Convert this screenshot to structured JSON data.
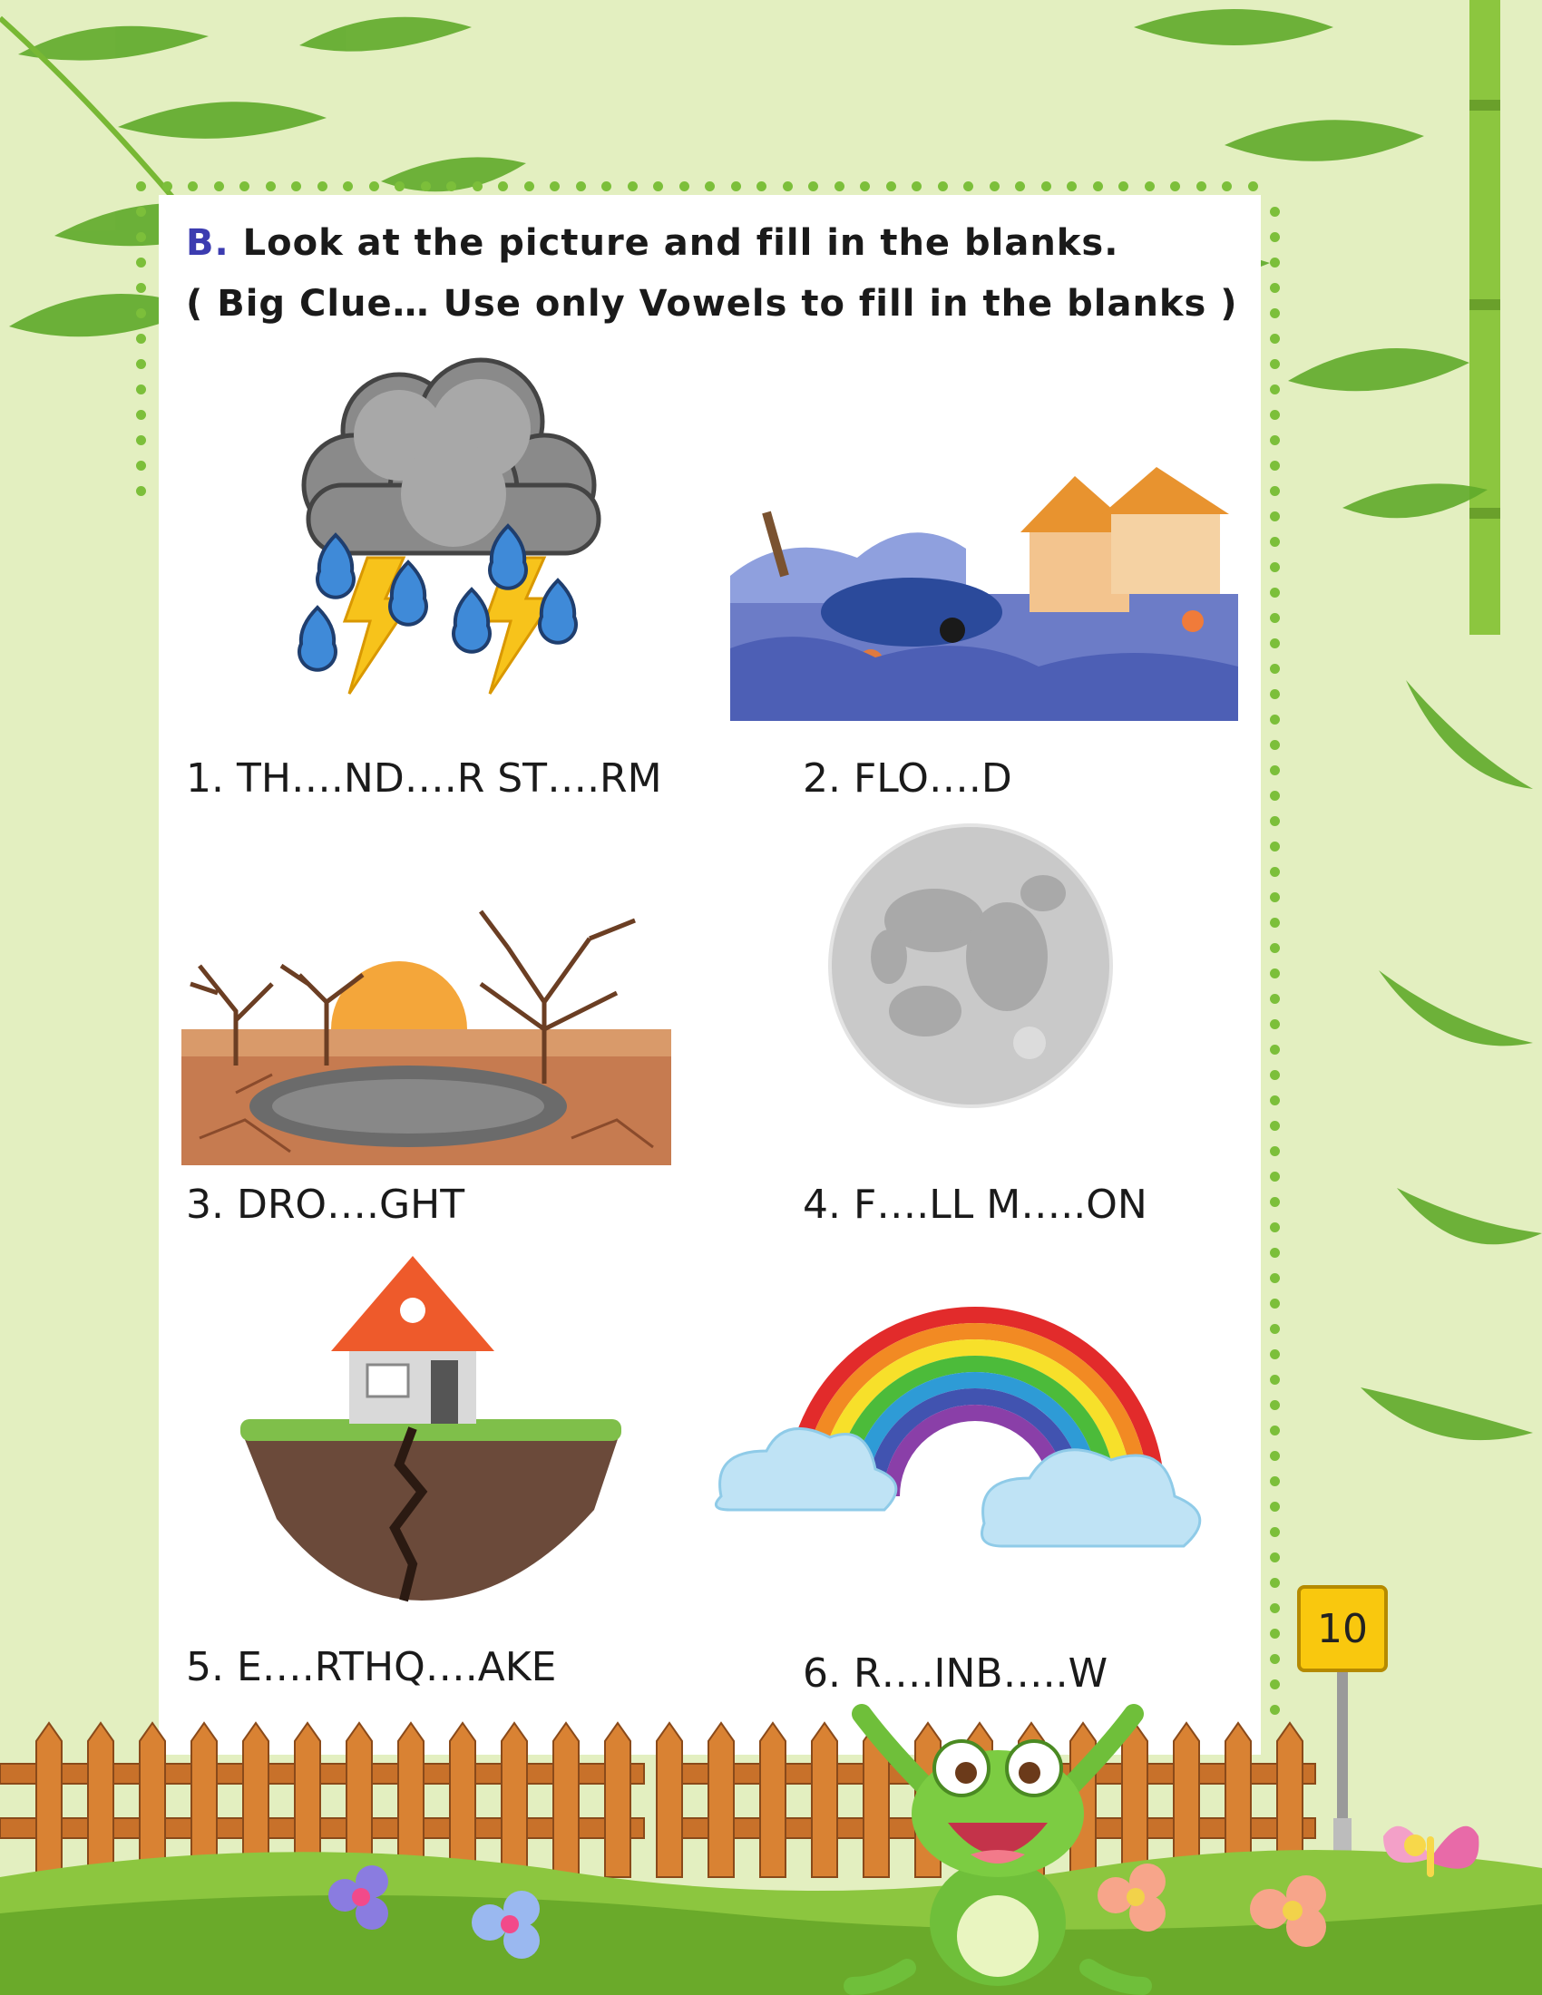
{
  "section": {
    "marker": "B.",
    "instruction": "Look at the picture and fill in the blanks.",
    "clue": "( Big Clue… Use only Vowels to fill in the blanks )"
  },
  "items": [
    {
      "label": "1.  TH….ND….R   ST….RM",
      "icon": "thunderstorm-icon"
    },
    {
      "label": "2. FLO….D",
      "icon": "flood-icon"
    },
    {
      "label": "3.  DRO….GHT",
      "icon": "drought-icon"
    },
    {
      "label": "4.  F….LL    M…..ON",
      "icon": "full-moon-icon"
    },
    {
      "label": "5.  E….RTHQ….AKE",
      "icon": "earthquake-icon"
    },
    {
      "label": "6. R….INB…..W",
      "icon": "rainbow-icon"
    }
  ],
  "page_number": "10",
  "colors": {
    "background": "#e3efc0",
    "panel": "#ffffff",
    "dots": "#7cbf3a",
    "marker": "#3c3cb0",
    "page_sign": "#f9c80e"
  }
}
